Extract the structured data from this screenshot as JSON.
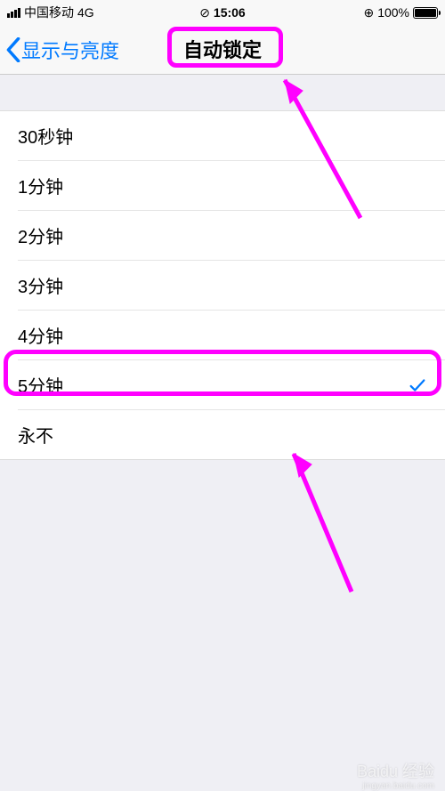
{
  "statusbar": {
    "carrier": "中国移动",
    "network": "4G",
    "time": "15:06",
    "battery_pct": "100%",
    "hotspot_icon": "link-icon",
    "lock_icon": "rotation-lock-icon"
  },
  "navbar": {
    "back_label": "显示与亮度",
    "title": "自动锁定"
  },
  "options": [
    {
      "label": "30秒钟",
      "selected": false
    },
    {
      "label": "1分钟",
      "selected": false
    },
    {
      "label": "2分钟",
      "selected": false
    },
    {
      "label": "3分钟",
      "selected": false
    },
    {
      "label": "4分钟",
      "selected": false
    },
    {
      "label": "5分钟",
      "selected": true
    },
    {
      "label": "永不",
      "selected": false
    }
  ],
  "annotations": {
    "highlight_title": true,
    "highlight_selected": true
  },
  "watermark": {
    "brand": "Baidu 经验",
    "sub": "jingyan.baidu.com"
  }
}
